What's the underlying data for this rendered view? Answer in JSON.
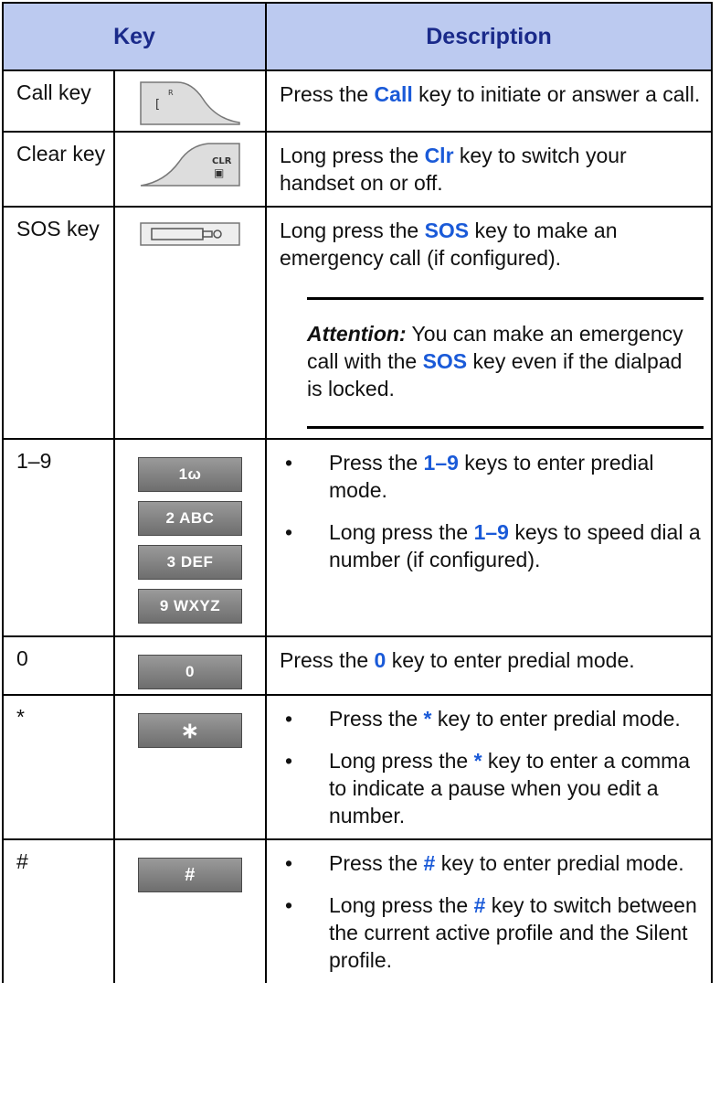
{
  "header": {
    "key": "Key",
    "description": "Description"
  },
  "rows": [
    {
      "name": "Call key",
      "icon": "call-key-icon",
      "desc": {
        "pre": "Press the ",
        "kw": "Call",
        "post": " key to initiate or answer a call."
      }
    },
    {
      "name": "Clear key",
      "icon": "clear-key-icon",
      "icon_text": [
        "CLR",
        "▣"
      ],
      "desc": {
        "pre": "Long press the ",
        "kw": "Clr",
        "post": " key to switch your handset on or off."
      }
    },
    {
      "name": "SOS key",
      "icon": "sos-key-icon",
      "desc": {
        "pre": "Long press the ",
        "kw": "SOS",
        "post": " key to make an emergency call (if configured)."
      },
      "note": {
        "label": "Attention:",
        "pre": " You can make an emergency call with the ",
        "kw": "SOS",
        "post": " key even if the dialpad is locked."
      }
    },
    {
      "name": "1–9",
      "keys": [
        "1ω",
        "2 ABC",
        "3 DEF",
        "9 WXYZ"
      ],
      "bullets": [
        {
          "pre": "Press the ",
          "kw": "1–9",
          "post": " keys to enter predial mode."
        },
        {
          "pre": "Long press the ",
          "kw": "1–9",
          "post": " keys to speed dial a number (if configured)."
        }
      ]
    },
    {
      "name": "0",
      "keys": [
        "0"
      ],
      "desc": {
        "pre": "Press the ",
        "kw": "0",
        "post": " key to enter predial mode."
      }
    },
    {
      "name": "*",
      "keys": [
        "∗"
      ],
      "bullets": [
        {
          "pre": "Press the ",
          "kw": "*",
          "post": " key to enter predial mode."
        },
        {
          "pre": "Long press the ",
          "kw": "*",
          "post": " key to enter a comma to indicate a pause when you edit a number."
        }
      ]
    },
    {
      "name": "#",
      "keys": [
        "#"
      ],
      "bullets": [
        {
          "pre": "Press the ",
          "kw": "#",
          "post": " key to enter predial mode."
        },
        {
          "pre": "Long press the ",
          "kw": "#",
          "post": " key to switch between the current active profile and the Silent profile."
        }
      ]
    }
  ]
}
